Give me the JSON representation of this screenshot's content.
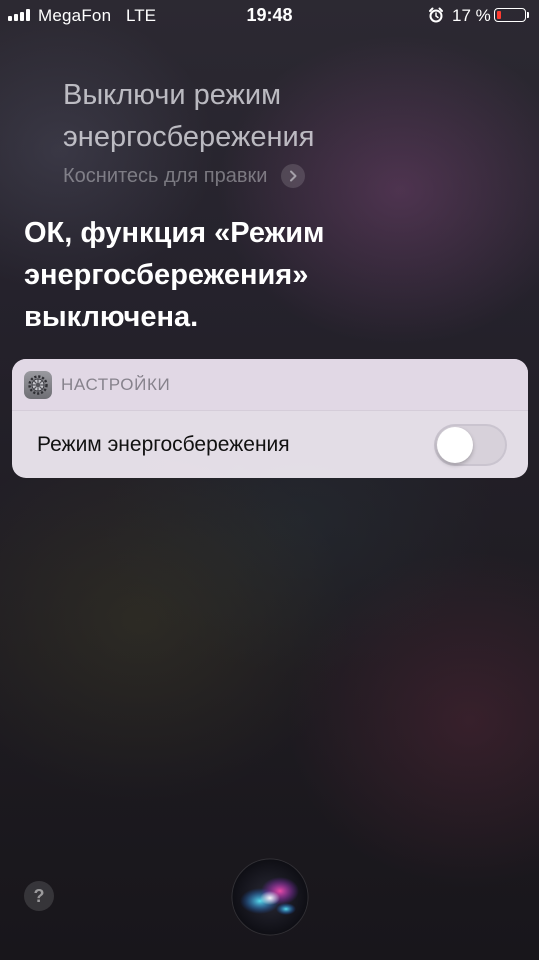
{
  "status_bar": {
    "carrier": "MegaFon",
    "network": "LTE",
    "time": "19:48",
    "battery_percent": "17 %",
    "battery_level": 0.17,
    "battery_color": "#ff3b30",
    "icons": [
      "signal-bars-icon",
      "alarm-clock-icon",
      "battery-icon"
    ]
  },
  "siri": {
    "request_lines": [
      "Выключи режим",
      "энергосбережения"
    ],
    "tap_to_edit": "Коснитесь для правки",
    "response_lines": [
      "ОК, функция «Режим",
      "энергосбережения»",
      "выключена."
    ]
  },
  "settings_card": {
    "app_name": "НАСТРОЙКИ",
    "app_icon": "settings-gear-icon",
    "row_label": "Режим энергосбережения",
    "toggle_on": false
  },
  "bottom": {
    "help_label": "?",
    "help_icon": "help-icon",
    "siri_icon": "siri-orb-icon"
  }
}
